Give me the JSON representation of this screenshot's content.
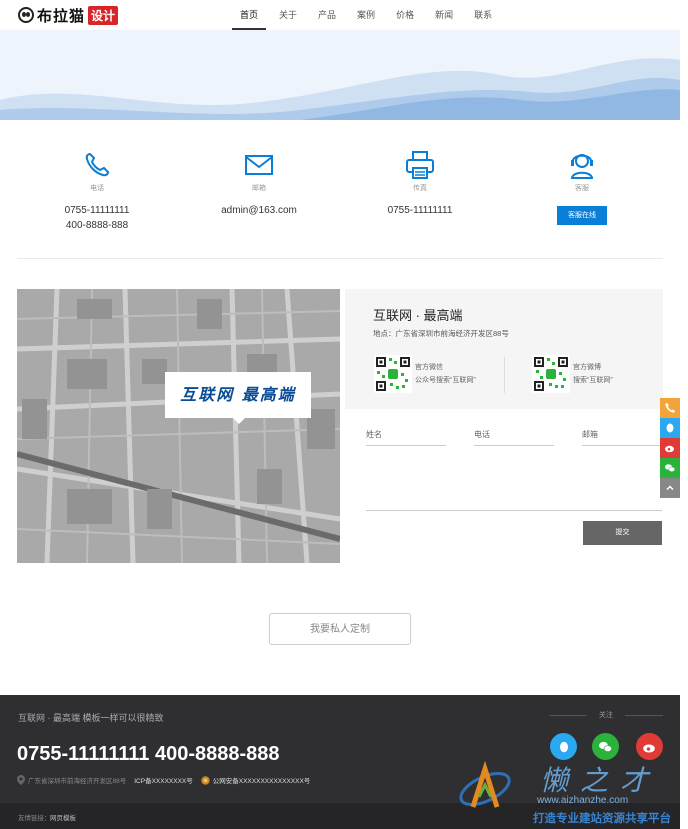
{
  "header": {
    "logo_name": "布拉猫",
    "logo_tag": "设计",
    "nav": [
      "首页",
      "关于",
      "产品",
      "案例",
      "价格",
      "新闻",
      "联系"
    ]
  },
  "contacts": [
    {
      "icon": "phone-icon",
      "label": "电话",
      "values": [
        "0755-11111111",
        "400-8888-888"
      ]
    },
    {
      "icon": "mail-icon",
      "label": "邮箱",
      "values": [
        "admin@163.com"
      ]
    },
    {
      "icon": "fax-icon",
      "label": "传真",
      "values": [
        "0755-11111111"
      ]
    },
    {
      "icon": "customer-service-icon",
      "label": "客服",
      "button": "客服在线"
    }
  ],
  "map": {
    "label": "互联网 最高端"
  },
  "info": {
    "title": "互联网 · 最高端",
    "address": "地点：广东省深圳市前海经济开发区88号",
    "wechat_title": "官方微信",
    "wechat_sub": "公众号搜索“互联网”",
    "weibo_title": "官方微博",
    "weibo_sub": "搜索“互联网”"
  },
  "form": {
    "name_placeholder": "姓名",
    "phone_placeholder": "电话",
    "email_placeholder": "邮箱",
    "submit": "提交"
  },
  "cta": "我要私人定制",
  "footer": {
    "slogan": "互联网 · 最高端 模板一样可以很精致",
    "phone": "0755-11111111 400-8888-888",
    "address": "广东省深圳市前海经济开发区88号",
    "icp": "ICP备XXXXXXXX号",
    "police": "公网安备XXXXXXXXXXXXXXX号",
    "follow": "关注",
    "social": [
      "qq-icon",
      "wechat-icon",
      "weibo-icon"
    ],
    "links": [
      "友情链接：",
      "网页模板"
    ]
  },
  "watermark": {
    "cn": "懒之才",
    "url": "www.aizhanzhe.com",
    "slogan": "打造专业建站资源共享平台"
  },
  "colors": {
    "accent": "#0a7fd8",
    "footer_bg": "#2f2f31",
    "qq": "#2aa8f0",
    "wechat": "#2bb23b",
    "weibo": "#e03b36",
    "phone_side": "#f2a33a"
  }
}
